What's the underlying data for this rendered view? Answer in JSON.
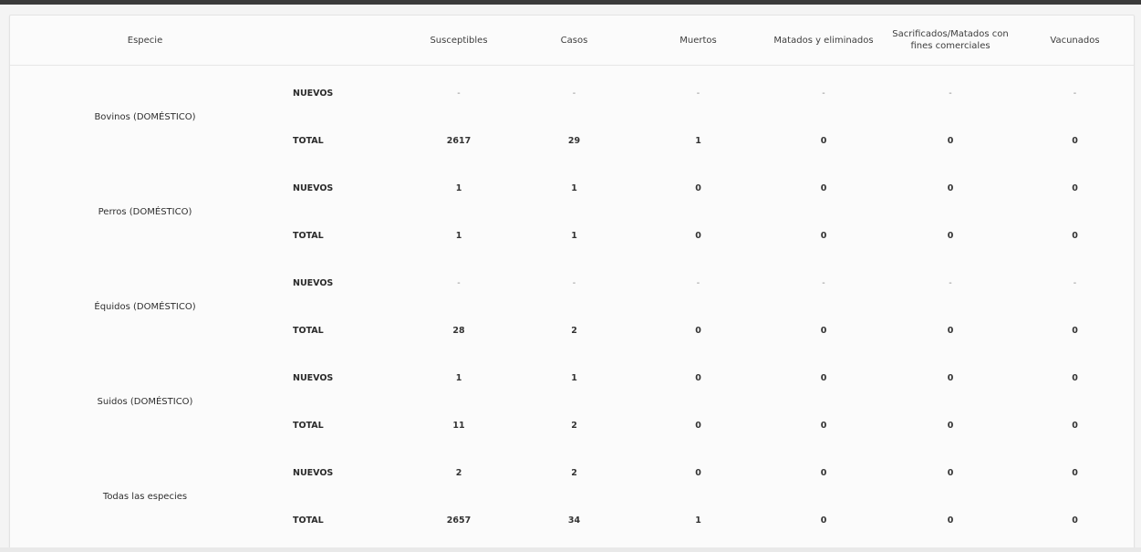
{
  "headers": {
    "species": "Especie",
    "type": "",
    "susceptibles": "Susceptibles",
    "casos": "Casos",
    "muertos": "Muertos",
    "matados": "Matados y eliminados",
    "sacrificados": "Sacrificados/Matados con fines comerciales",
    "vacunados": "Vacunados"
  },
  "rows": [
    {
      "species": "Bovinos (DOMÉSTICO)",
      "nuevos": {
        "label": "NUEVOS",
        "susceptibles": "-",
        "casos": "-",
        "muertos": "-",
        "matados": "-",
        "sacrificados": "-",
        "vacunados": "-"
      },
      "total": {
        "label": "TOTAL",
        "susceptibles": "2617",
        "casos": "29",
        "muertos": "1",
        "matados": "0",
        "sacrificados": "0",
        "vacunados": "0"
      }
    },
    {
      "species": "Perros (DOMÉSTICO)",
      "nuevos": {
        "label": "NUEVOS",
        "susceptibles": "1",
        "casos": "1",
        "muertos": "0",
        "matados": "0",
        "sacrificados": "0",
        "vacunados": "0"
      },
      "total": {
        "label": "TOTAL",
        "susceptibles": "1",
        "casos": "1",
        "muertos": "0",
        "matados": "0",
        "sacrificados": "0",
        "vacunados": "0"
      }
    },
    {
      "species": "Équidos (DOMÉSTICO)",
      "nuevos": {
        "label": "NUEVOS",
        "susceptibles": "-",
        "casos": "-",
        "muertos": "-",
        "matados": "-",
        "sacrificados": "-",
        "vacunados": "-"
      },
      "total": {
        "label": "TOTAL",
        "susceptibles": "28",
        "casos": "2",
        "muertos": "0",
        "matados": "0",
        "sacrificados": "0",
        "vacunados": "0"
      }
    },
    {
      "species": "Suidos (DOMÉSTICO)",
      "nuevos": {
        "label": "NUEVOS",
        "susceptibles": "1",
        "casos": "1",
        "muertos": "0",
        "matados": "0",
        "sacrificados": "0",
        "vacunados": "0"
      },
      "total": {
        "label": "TOTAL",
        "susceptibles": "11",
        "casos": "2",
        "muertos": "0",
        "matados": "0",
        "sacrificados": "0",
        "vacunados": "0"
      }
    },
    {
      "species": "Todas las especies",
      "nuevos": {
        "label": "NUEVOS",
        "susceptibles": "2",
        "casos": "2",
        "muertos": "0",
        "matados": "0",
        "sacrificados": "0",
        "vacunados": "0"
      },
      "total": {
        "label": "TOTAL",
        "susceptibles": "2657",
        "casos": "34",
        "muertos": "1",
        "matados": "0",
        "sacrificados": "0",
        "vacunados": "0"
      }
    }
  ]
}
